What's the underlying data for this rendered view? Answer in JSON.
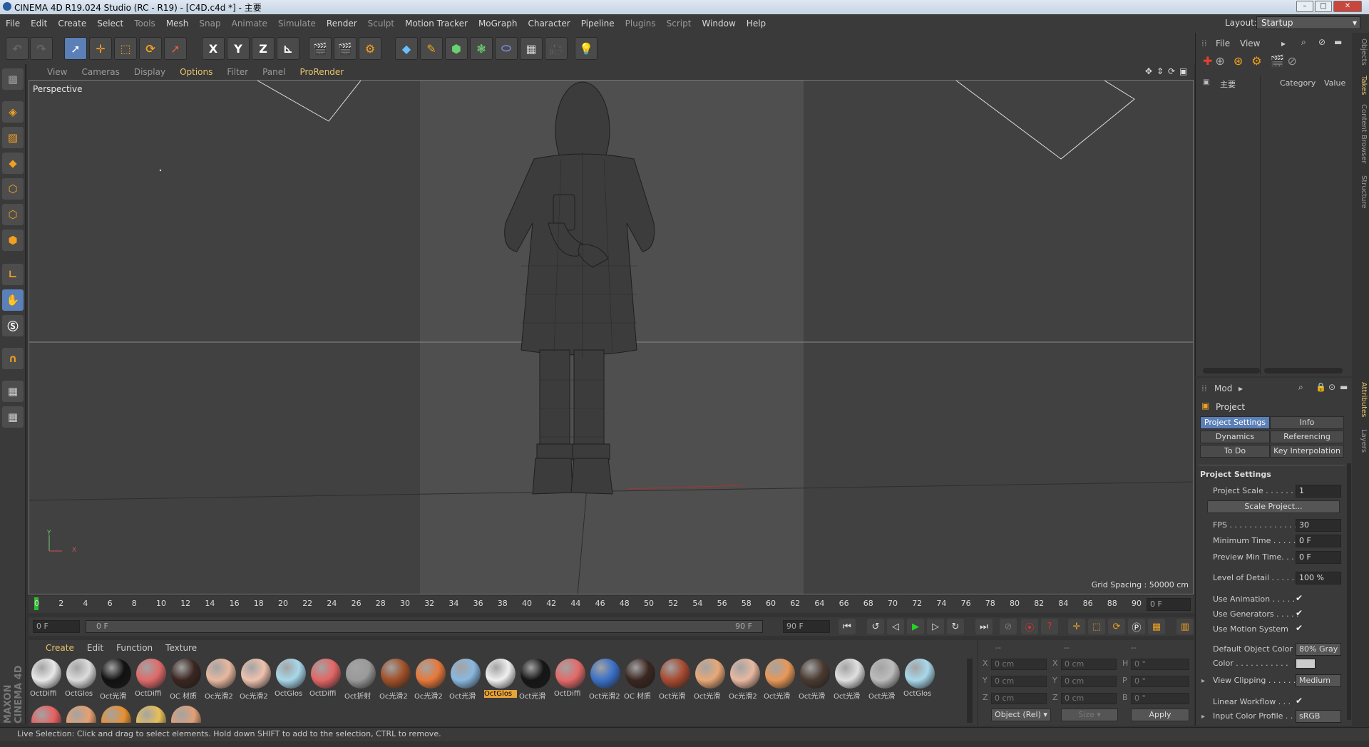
{
  "window": {
    "title": "CINEMA 4D R19.024 Studio (RC - R19) - [C4D.c4d *] - 主要"
  },
  "menu": [
    "File",
    "Edit",
    "Create",
    "Select",
    "Tools",
    "Mesh",
    "Snap",
    "Animate",
    "Simulate",
    "Render",
    "Sculpt",
    "Motion Tracker",
    "MoGraph",
    "Character",
    "Pipeline",
    "Plugins",
    "Script",
    "Window",
    "Help"
  ],
  "layout": {
    "label": "Layout:",
    "value": "Startup"
  },
  "toolbar": {
    "x": "X",
    "y": "Y",
    "z": "Z"
  },
  "viewport_menu": [
    "View",
    "Cameras",
    "Display",
    "Options",
    "Filter",
    "Panel",
    "ProRender"
  ],
  "viewport": {
    "label": "Perspective",
    "grid_spacing": "Grid Spacing : 50000 cm",
    "axis_y": "Y",
    "axis_x": "X"
  },
  "timeline": {
    "ticks": [
      "0",
      "2",
      "4",
      "6",
      "8",
      "10",
      "12",
      "14",
      "16",
      "18",
      "20",
      "22",
      "24",
      "26",
      "28",
      "30",
      "32",
      "34",
      "36",
      "38",
      "40",
      "42",
      "44",
      "46",
      "48",
      "50",
      "52",
      "54",
      "56",
      "58",
      "60",
      "62",
      "64",
      "66",
      "68",
      "70",
      "72",
      "74",
      "76",
      "78",
      "80",
      "82",
      "84",
      "86",
      "88",
      "90"
    ],
    "current_frame": "0 F",
    "start": "0 F",
    "range_start": "0 F",
    "range_end": "90 F",
    "end": "90 F"
  },
  "material_menu": [
    "Create",
    "Edit",
    "Function",
    "Texture"
  ],
  "materials": [
    {
      "label": "OctDiffi",
      "color": "#e8e8e8"
    },
    {
      "label": "OctGlos",
      "color": "#dcdcdc"
    },
    {
      "label": "Oct光滑",
      "color": "#111111"
    },
    {
      "label": "OctDiffi",
      "color": "#e06a6a"
    },
    {
      "label": "OC 材质",
      "color": "#3a2620"
    },
    {
      "label": "Oc光滑2",
      "color": "#e8b8a0"
    },
    {
      "label": "Oc光滑2",
      "color": "#eec2ae"
    },
    {
      "label": "OctGlos",
      "color": "#a8d8ea"
    },
    {
      "label": "OctDiffi",
      "color": "#e46666"
    },
    {
      "label": "Oct折射",
      "color": "#9a9a9a"
    },
    {
      "label": "Oc光滑2",
      "color": "#a05028"
    },
    {
      "label": "Oc光滑2",
      "color": "#e8783a"
    },
    {
      "label": "Oct光滑",
      "color": "#8ab8e0"
    },
    {
      "label": "OctGlos",
      "color": "#f0f0f0"
    },
    {
      "label": "Oct光滑",
      "color": "#151515"
    },
    {
      "label": "OctDiffi",
      "color": "#e46a6a"
    },
    {
      "label": "Oct光滑2",
      "color": "#3a70c8"
    },
    {
      "label": "OC 材质",
      "color": "#3a2620"
    },
    {
      "label": "Oct光滑",
      "color": "#a84a30"
    },
    {
      "label": "Oct光滑",
      "color": "#e8a878"
    },
    {
      "label": "Oc光滑2",
      "color": "#e8b8a0"
    },
    {
      "label": "Oct光滑",
      "color": "#e89858"
    },
    {
      "label": "Oct光滑",
      "color": "#4a3a30"
    },
    {
      "label": "Oct光滑",
      "color": "#e0e0e0"
    },
    {
      "label": "Oct光滑",
      "color": "#bcbcbc"
    },
    {
      "label": "OctGlos",
      "color": "#a8d8ea"
    }
  ],
  "materials_row2": [
    "#e86060",
    "#e8a070",
    "#e89030",
    "#e8c058",
    "#e0a078"
  ],
  "selected_material_index": 13,
  "coords": {
    "x": "X",
    "y": "Y",
    "z": "Z",
    "h": "H",
    "p": "P",
    "b": "B",
    "x_pos": "0 cm",
    "y_pos": "0 cm",
    "z_pos": "0 cm",
    "x_size": "0 cm",
    "y_size": "0 cm",
    "z_size": "0 cm",
    "h_rot": "0 °",
    "p_rot": "0 °",
    "b_rot": "0 °",
    "header": "--",
    "mode": "Object (Rel)",
    "size_mode": "Size",
    "apply": "Apply"
  },
  "status": "Live Selection: Click and drag to select elements. Hold down SHIFT to add to the selection, CTRL to remove.",
  "objects": {
    "menu": [
      "File",
      "View"
    ],
    "item": "主要",
    "col_category": "Category",
    "col_value": "Value"
  },
  "right_tabs": [
    "Objects",
    "Takes",
    "Content Browser",
    "Structure",
    "Attributes",
    "Layers"
  ],
  "attributes": {
    "mode": "Mod",
    "title": "Project",
    "tabs": [
      "Project Settings",
      "Info",
      "Dynamics",
      "Referencing",
      "To Do",
      "Key Interpolation"
    ],
    "section": "Project Settings",
    "project_scale_label": "Project Scale . . . . . . .",
    "project_scale": "1",
    "scale_project": "Scale Project...",
    "fps_label": "FPS . . . . . . . . . . . . . . .",
    "fps": "30",
    "min_time_label": "Minimum Time . . . . .",
    "min_time": "0 F",
    "preview_min_label": "Preview Min Time. . .",
    "preview_min": "0 F",
    "lod_label": "Level of Detail . . . . . .",
    "lod": "100 %",
    "use_anim_label": "Use Animation . . . . .",
    "use_gen_label": "Use Generators . . . . .",
    "use_motion_label": "Use Motion System",
    "check": "✔",
    "default_color_label": "Default Object Color",
    "default_color": "80% Gray",
    "color_label": "Color . . . . . . . . . . .",
    "view_clipping_label": "View Clipping . . . . . .",
    "view_clipping": "Medium",
    "linear_workflow_label": "Linear Workflow . . .",
    "input_profile_label": "Input Color Profile . .",
    "input_profile": "sRGB"
  },
  "brand": "MAXON CINEMA 4D"
}
